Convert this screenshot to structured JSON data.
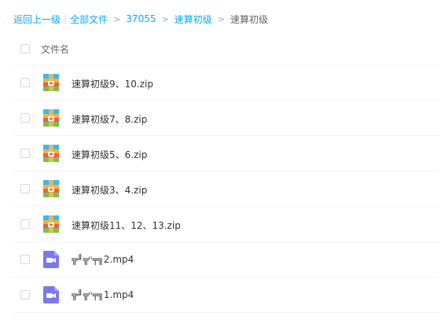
{
  "breadcrumb": {
    "back": "返回上一级",
    "separator_bar": "|",
    "all_files": "全部文件",
    "sep": ">",
    "folder1": "37055",
    "folder2": "速算初级",
    "current": "速算初级"
  },
  "header": {
    "name_label": "文件名"
  },
  "files": [
    {
      "name": "速算初级9、10.zip",
      "icon": "zip-icon"
    },
    {
      "name": "速算初级7、8.zip",
      "icon": "zip-icon"
    },
    {
      "name": "速算初级5、6.zip",
      "icon": "zip-icon"
    },
    {
      "name": "速算初级3、4.zip",
      "icon": "zip-icon"
    },
    {
      "name": "速算初级11、12、13.zip",
      "icon": "zip-icon"
    },
    {
      "name": "╦╜╦ⁿ╤╗2.mp4",
      "icon": "video-icon"
    },
    {
      "name": "╦╜╦ⁿ╤╗1.mp4",
      "icon": "video-icon"
    }
  ],
  "colors": {
    "link": "#09aaff",
    "video_icon": "#7a78f0"
  }
}
